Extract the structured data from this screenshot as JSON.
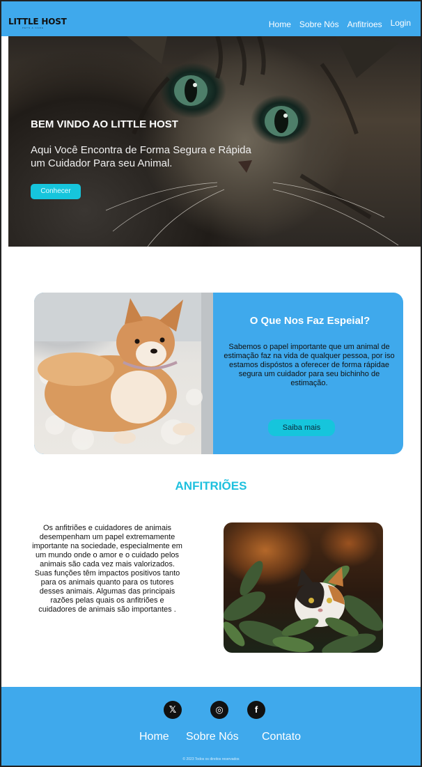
{
  "nav": {
    "logo": "LITTLE HOST",
    "logo_sub": "PETS & CARE",
    "links": [
      "Home",
      "Sobre Nós",
      "Anfitrioes",
      "Login"
    ]
  },
  "hero": {
    "title": "BEM VINDO AO LITTLE HOST",
    "subtitle": "Aqui Você Encontra de Forma Segura e Rápida um Cuidador Para seu Animal.",
    "button": "Conhecer"
  },
  "special": {
    "title": "O Que Nos Faz Espeial?",
    "text": "Sabemos o papel importante que um animal de estimação faz na vida de qualquer pessoa, por iso estamos dispóstos a oferecer de forma rápidae segura um cuidador para seu bichinho de estimação.",
    "button": "Saiba mais"
  },
  "anfitrioes": {
    "title": "ANFITRIÕES",
    "text": "Os anfitriões e cuidadores de animais desempenham um papel extremamente importante na sociedade, especialmente em um mundo onde o amor e o cuidado pelos animais são cada vez mais valorizados. Suas funções têm impactos positivos tanto para os animais quanto para os tutores desses animais. Algumas das principais razões pelas quais os anfitriões e cuidadores de animais são importantes ."
  },
  "footer": {
    "social": [
      {
        "icon": "x-icon",
        "glyph": "𝕏"
      },
      {
        "icon": "instagram-icon",
        "glyph": "◎"
      },
      {
        "icon": "facebook-icon",
        "glyph": "f"
      }
    ],
    "links": [
      "Home",
      "Sobre Nós",
      "Contato"
    ],
    "copyright": "© 2023 Todos os direitos reservados"
  },
  "colors": {
    "primary": "#3fa9ec",
    "accent": "#16c5dc",
    "heading": "#1ec0de"
  }
}
